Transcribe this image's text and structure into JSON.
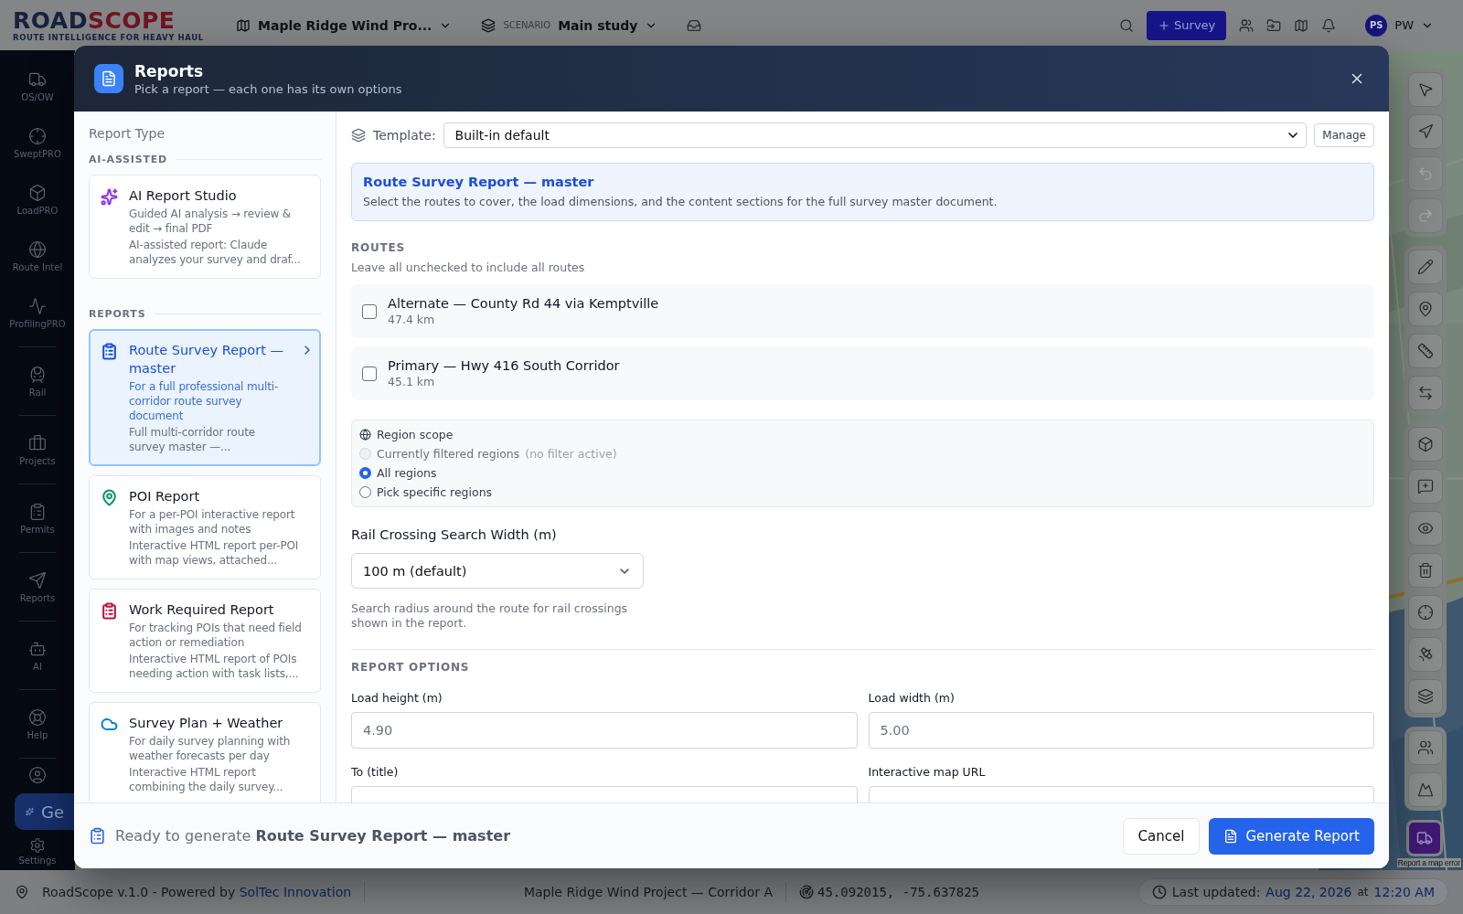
{
  "topbar": {
    "logo_first": "ROAD",
    "logo_second": "SCOPE",
    "tagline": "ROUTE INTELLIGENCE FOR HEAVY HAUL",
    "project": "Maple Ridge Wind Pro...",
    "scenario_label": "SCENARIO",
    "scenario": "Main study",
    "survey_button": "Survey",
    "avatar": "PS",
    "user": "PW"
  },
  "nav": {
    "items": [
      {
        "label": "OS/OW"
      },
      {
        "label": "SweptPRO"
      },
      {
        "label": "LoadPRO"
      },
      {
        "label": "Route Intel"
      },
      {
        "label": "ProfilingPRO"
      },
      {
        "label": "Rail"
      },
      {
        "label": "Projects"
      },
      {
        "label": "Permits"
      },
      {
        "label": "Reports"
      },
      {
        "label": "AI"
      },
      {
        "label": "Help"
      }
    ],
    "generate_button": "Ge",
    "settings": "Settings"
  },
  "map": {
    "report_error": "Report a map error",
    "tool_groups": [
      {
        "tools": [
          {
            "disabled": false
          },
          {
            "disabled": false
          },
          {
            "disabled": true
          },
          {
            "disabled": true
          }
        ]
      },
      {
        "tools": [
          {
            "disabled": false
          },
          {
            "disabled": false
          },
          {
            "disabled": false
          },
          {
            "disabled": false
          }
        ]
      },
      {
        "tools": [
          {
            "disabled": false
          },
          {
            "disabled": false
          },
          {
            "disabled": false
          },
          {
            "disabled": false
          },
          {
            "disabled": false
          },
          {
            "disabled": false
          },
          {
            "disabled": false
          }
        ]
      },
      {
        "tools": [
          {
            "disabled": false
          },
          {
            "disabled": false
          }
        ]
      }
    ]
  },
  "modal": {
    "title": "Reports",
    "subtitle": "Pick a report — each one has its own options",
    "sidebar": {
      "heading": "Report Type",
      "groups": [
        {
          "label": "AI-ASSISTED",
          "items": [
            {
              "title": "AI Report Studio",
              "purpose": "Guided AI analysis → review & edit → final PDF",
              "description": "AI-assisted report: Claude analyzes your survey and draf...",
              "color": "#9333ea",
              "selected": false
            }
          ]
        },
        {
          "label": "REPORTS",
          "items": [
            {
              "title": "Route Survey Report — master",
              "purpose": "For a full professional multi-corridor route survey document",
              "description": "Full multi-corridor route survey master —...",
              "color": "#1d4ed8",
              "selected": true
            },
            {
              "title": "POI Report",
              "purpose": "For a per-POI interactive report with images and notes",
              "description": "Interactive HTML report per-POI with map views, attached...",
              "color": "#059669",
              "selected": false
            },
            {
              "title": "Work Required Report",
              "purpose": "For tracking POIs that need field action or remediation",
              "description": "Interactive HTML report of POIs needing action with task lists,...",
              "color": "#be123c",
              "selected": false
            },
            {
              "title": "Survey Plan + Weather",
              "purpose": "For daily survey planning with weather forecasts per day",
              "description": "Interactive HTML report combining the daily survey...",
              "color": "#0284c7",
              "selected": false
            }
          ]
        }
      ]
    },
    "template": {
      "label": "Template:",
      "value": "Built-in default",
      "manage": "Manage"
    },
    "info": {
      "title": "Route Survey Report — master",
      "text": "Select the routes to cover, the load dimensions, and the content sections for the full survey master document."
    },
    "routes": {
      "heading": "ROUTES",
      "hint": "Leave all unchecked to include all routes",
      "items": [
        {
          "name": "Alternate — County Rd 44 via Kemptville",
          "distance": "47.4 km",
          "checked": false
        },
        {
          "name": "Primary — Hwy 416 South Corridor",
          "distance": "45.1 km",
          "checked": false
        }
      ]
    },
    "region_scope": {
      "label": "Region scope",
      "options": [
        {
          "label": "Currently filtered regions",
          "note": "(no filter active)",
          "selected": false,
          "disabled": true
        },
        {
          "label": "All regions",
          "selected": true,
          "disabled": false
        },
        {
          "label": "Pick specific regions",
          "selected": false,
          "disabled": false
        }
      ]
    },
    "rail": {
      "label": "Rail Crossing Search Width (m)",
      "value": "100 m (default)",
      "hint": "Search radius around the route for rail crossings shown in the report."
    },
    "options": {
      "heading": "REPORT OPTIONS",
      "fields": [
        {
          "label": "Load height (m)",
          "value": "4.90"
        },
        {
          "label": "Load width (m)",
          "value": "5.00"
        },
        {
          "label": "To (title)"
        },
        {
          "label": "Interactive map URL"
        }
      ]
    },
    "footer": {
      "status": "Ready to generate **Route Survey Report — master**",
      "cancel": "Cancel",
      "generate": "Generate Report"
    }
  },
  "status_bar": {
    "credit": "RoadScope v.1.0 - Powered by",
    "company": "SolTec Innovation",
    "project": "Maple Ridge Wind Project — Corridor A",
    "coordinates": "45.092015, -75.637825",
    "updated_label": "Last updated:",
    "updated_date": "Aug 22, 2026",
    "updated_at": "at",
    "updated_time": "12:20 AM"
  }
}
